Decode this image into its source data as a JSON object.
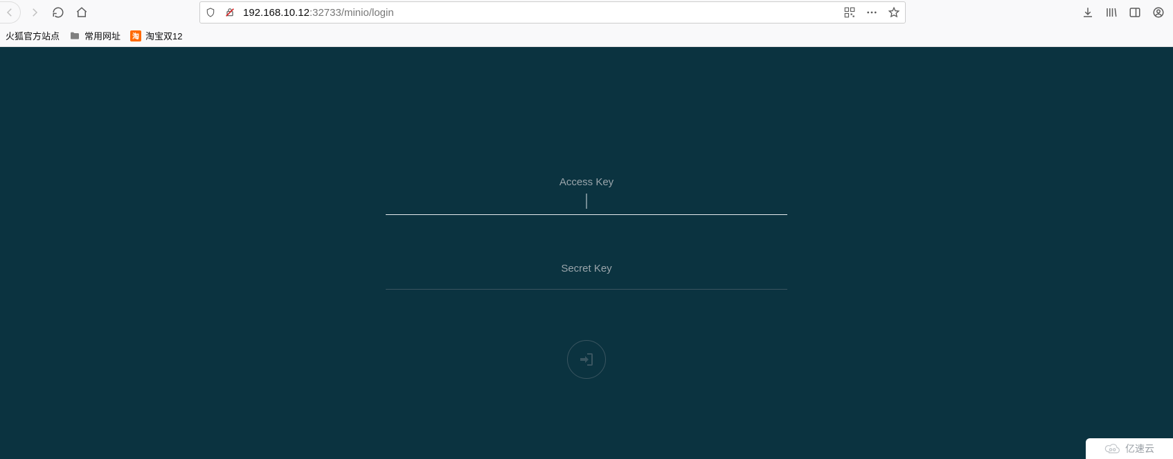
{
  "browser": {
    "url_host": "192.168.10.12",
    "url_port_path": ":32733/minio/login"
  },
  "bookmarks": {
    "item1": "火狐官方站点",
    "item2": "常用网址",
    "item3": "淘宝双12"
  },
  "login": {
    "access_key_label": "Access Key",
    "secret_key_label": "Secret Key",
    "access_key_value": "",
    "secret_key_value": ""
  },
  "watermark": {
    "text": "亿速云"
  }
}
